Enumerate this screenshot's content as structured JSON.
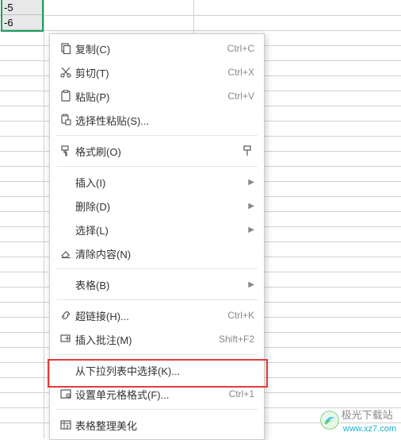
{
  "cells": {
    "a1": "-5",
    "a2": "-6"
  },
  "menu": {
    "copy": {
      "label": "复制(C)",
      "shortcut": "Ctrl+C"
    },
    "cut": {
      "label": "剪切(T)",
      "shortcut": "Ctrl+X"
    },
    "paste": {
      "label": "粘贴(P)",
      "shortcut": "Ctrl+V"
    },
    "paste_special": {
      "label": "选择性粘贴(S)..."
    },
    "format_painter": {
      "label": "格式刷(O)"
    },
    "insert": {
      "label": "插入(I)"
    },
    "delete": {
      "label": "删除(D)"
    },
    "select": {
      "label": "选择(L)"
    },
    "clear": {
      "label": "清除内容(N)"
    },
    "table": {
      "label": "表格(B)"
    },
    "hyperlink": {
      "label": "超链接(H)...",
      "shortcut": "Ctrl+K"
    },
    "comment": {
      "label": "插入批注(M)",
      "shortcut": "Shift+F2"
    },
    "dropdown": {
      "label": "从下拉列表中选择(K)..."
    },
    "format_cells": {
      "label": "设置单元格格式(F)...",
      "shortcut": "Ctrl+1"
    },
    "beautify": {
      "label": "表格整理美化"
    }
  },
  "watermark": {
    "name": "极光下载站",
    "url": "www.xz7.com"
  },
  "colors": {
    "selection_border": "#1aa05d",
    "highlight_border": "#e23b3b"
  }
}
